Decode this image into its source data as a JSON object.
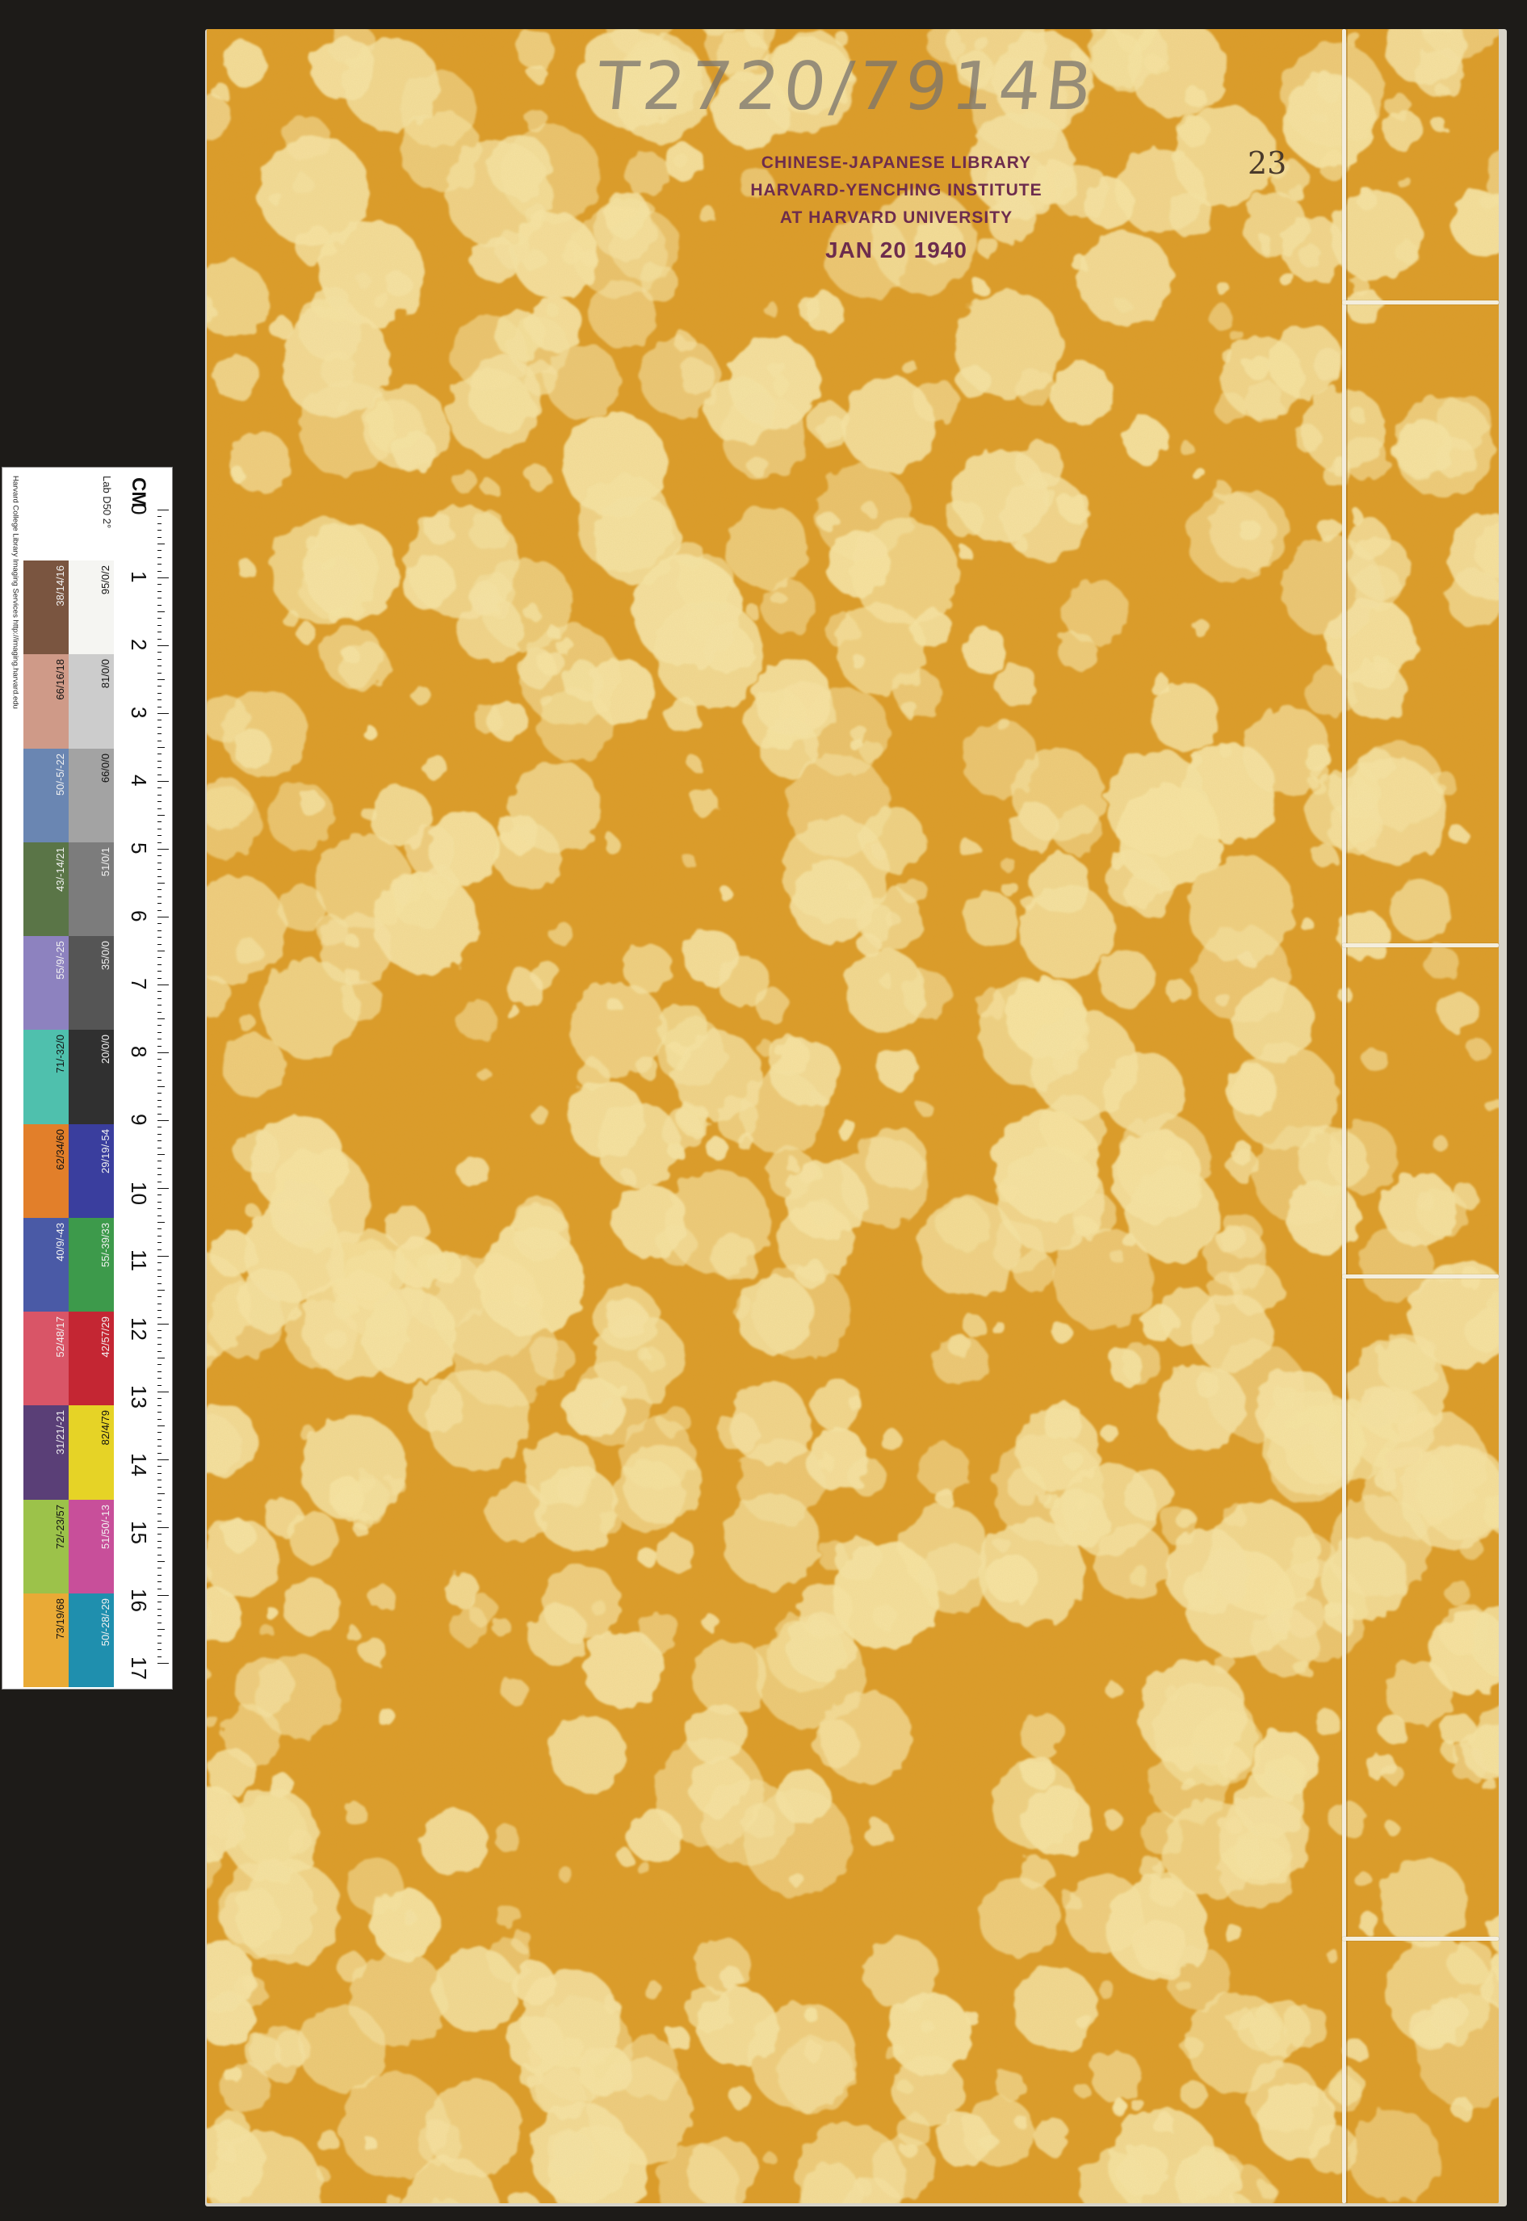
{
  "stamp": {
    "line1": "CHINESE-JAPANESE LIBRARY",
    "line2": "HARVARD-YENCHING INSTITUTE",
    "line3": "AT HARVARD UNIVERSITY",
    "date": "JAN 20 1940"
  },
  "handwritten_call_number": "T2720/7914B",
  "volume_number": "23",
  "color_target": {
    "credit": "Harvard College Library Imaging Services http://imaging.harvard.edu",
    "lab_header": "Lab D50 2°",
    "ruler_unit": "CM",
    "ruler_numbers": [
      "0",
      "1",
      "2",
      "3",
      "4",
      "5",
      "6",
      "7",
      "8",
      "9",
      "10",
      "11",
      "12",
      "13",
      "14",
      "15",
      "16",
      "17"
    ],
    "swatches": [
      {
        "label": "38/14/16",
        "color": "#7a5540",
        "dark": true
      },
      {
        "label": "95/0/2",
        "color": "#f5f5f2",
        "dark": false
      },
      {
        "label": "66/16/18",
        "color": "#cf9a88",
        "dark": false
      },
      {
        "label": "81/0/0",
        "color": "#cccccc",
        "dark": false
      },
      {
        "label": "50/-5/-22",
        "color": "#6a86b2",
        "dark": true
      },
      {
        "label": "66/0/0",
        "color": "#a3a3a3",
        "dark": false
      },
      {
        "label": "43/-14/21",
        "color": "#5a7547",
        "dark": true
      },
      {
        "label": "51/0/1",
        "color": "#7c7c7c",
        "dark": true
      },
      {
        "label": "55/9/-25",
        "color": "#8d82bf",
        "dark": true
      },
      {
        "label": "35/0/0",
        "color": "#555555",
        "dark": true
      },
      {
        "label": "71/-32/0",
        "color": "#4fc0ad",
        "dark": false
      },
      {
        "label": "20/0/0",
        "color": "#303030",
        "dark": true
      },
      {
        "label": "62/34/60",
        "color": "#e27f2a",
        "dark": false
      },
      {
        "label": "29/19/-54",
        "color": "#3a3e9e",
        "dark": true
      },
      {
        "label": "40/9/-43",
        "color": "#4a5aa6",
        "dark": true
      },
      {
        "label": "55/-39/33",
        "color": "#3d9a4b",
        "dark": true
      },
      {
        "label": "52/48/17",
        "color": "#d95567",
        "dark": true
      },
      {
        "label": "42/57/29",
        "color": "#c42633",
        "dark": true
      },
      {
        "label": "31/21/-21",
        "color": "#5a3f77",
        "dark": true
      },
      {
        "label": "82/4/79",
        "color": "#e6d326",
        "dark": false
      },
      {
        "label": "72/-23/57",
        "color": "#9cc24a",
        "dark": false
      },
      {
        "label": "51/50/-13",
        "color": "#c84f9a",
        "dark": true
      },
      {
        "label": "73/19/68",
        "color": "#e9aa36",
        "dark": false
      },
      {
        "label": "50/-28/-29",
        "color": "#1f8fae",
        "dark": true
      }
    ]
  },
  "colors": {
    "cover_base": "#dc9c2a",
    "cover_spot": "#f6e4a6",
    "background": "#1d1b18"
  }
}
